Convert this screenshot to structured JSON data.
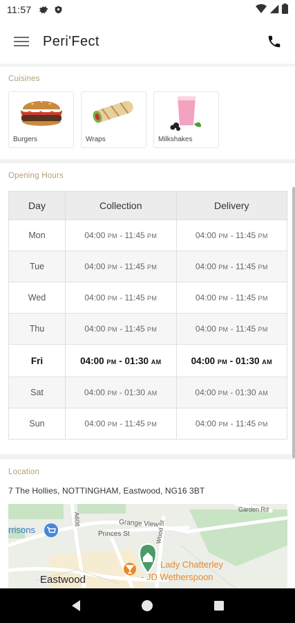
{
  "status_bar": {
    "time": "11:57"
  },
  "app_bar": {
    "title": "Peri'Fect"
  },
  "cuisines": {
    "label": "Cuisines",
    "items": [
      {
        "label": "Burgers"
      },
      {
        "label": "Wraps"
      },
      {
        "label": "Milkshakes"
      }
    ]
  },
  "opening_hours": {
    "label": "Opening Hours",
    "headers": [
      "Day",
      "Collection",
      "Delivery"
    ],
    "rows": [
      {
        "day": "Mon",
        "collection": {
          "open": "04:00",
          "open_ampm": "PM",
          "close": "11:45",
          "close_ampm": "PM"
        },
        "delivery": {
          "open": "04:00",
          "open_ampm": "PM",
          "close": "11:45",
          "close_ampm": "PM"
        }
      },
      {
        "day": "Tue",
        "collection": {
          "open": "04:00",
          "open_ampm": "PM",
          "close": "11:45",
          "close_ampm": "PM"
        },
        "delivery": {
          "open": "04:00",
          "open_ampm": "PM",
          "close": "11:45",
          "close_ampm": "PM"
        }
      },
      {
        "day": "Wed",
        "collection": {
          "open": "04:00",
          "open_ampm": "PM",
          "close": "11:45",
          "close_ampm": "PM"
        },
        "delivery": {
          "open": "04:00",
          "open_ampm": "PM",
          "close": "11:45",
          "close_ampm": "PM"
        }
      },
      {
        "day": "Thu",
        "collection": {
          "open": "04:00",
          "open_ampm": "PM",
          "close": "11:45",
          "close_ampm": "PM"
        },
        "delivery": {
          "open": "04:00",
          "open_ampm": "PM",
          "close": "11:45",
          "close_ampm": "PM"
        }
      },
      {
        "day": "Fri",
        "collection": {
          "open": "04:00",
          "open_ampm": "PM",
          "close": "01:30",
          "close_ampm": "AM"
        },
        "delivery": {
          "open": "04:00",
          "open_ampm": "PM",
          "close": "01:30",
          "close_ampm": "AM"
        }
      },
      {
        "day": "Sat",
        "collection": {
          "open": "04:00",
          "open_ampm": "PM",
          "close": "01:30",
          "close_ampm": "AM"
        },
        "delivery": {
          "open": "04:00",
          "open_ampm": "PM",
          "close": "01:30",
          "close_ampm": "AM"
        }
      },
      {
        "day": "Sun",
        "collection": {
          "open": "04:00",
          "open_ampm": "PM",
          "close": "11:45",
          "close_ampm": "PM"
        },
        "delivery": {
          "open": "04:00",
          "open_ampm": "PM",
          "close": "11:45",
          "close_ampm": "PM"
        }
      }
    ],
    "highlight_color": "#111111"
  },
  "location": {
    "label": "Location",
    "address": "7 The Hollies, NOTTINGHAM, Eastwood, NG16 3BT",
    "map": {
      "roads": [
        "Garden Rd",
        "Grange View",
        "Princes St",
        "Wood St",
        "A608"
      ],
      "places": [
        "rrisons",
        "Eastwood"
      ],
      "poi": [
        "Lady Chatterley",
        "- JD Wetherspoon"
      ]
    }
  },
  "colors": {
    "section_label": "#b59f7a",
    "table_header_bg": "#ececec",
    "map_marker": "#4a9a6a",
    "poi_orange": "#e8892b"
  }
}
